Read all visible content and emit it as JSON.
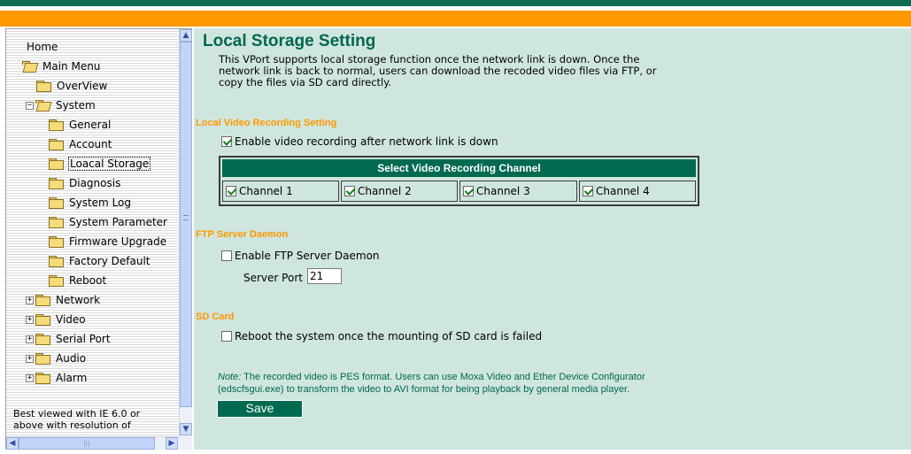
{
  "colors": {
    "header_green": "#0f6b50",
    "header_orange": "#ff9900",
    "content_background": "#cfe6de",
    "title_green": "#006650",
    "section_orange": "#ff9900",
    "button_green": "#006a50"
  },
  "sidebar": {
    "home": "Home",
    "main_menu": "Main Menu",
    "items": [
      {
        "label": "OverView",
        "icon": "folder-icon"
      },
      {
        "label": "System",
        "icon": "folder-open-icon",
        "expanded": true
      },
      {
        "label": "General",
        "icon": "folder-icon"
      },
      {
        "label": "Account",
        "icon": "folder-icon"
      },
      {
        "label": "Loacal Storage",
        "icon": "folder-icon",
        "selected": true
      },
      {
        "label": "Diagnosis",
        "icon": "folder-icon"
      },
      {
        "label": "System Log",
        "icon": "folder-icon"
      },
      {
        "label": "System Parameter",
        "icon": "folder-icon"
      },
      {
        "label": "Firmware Upgrade",
        "icon": "folder-icon"
      },
      {
        "label": "Factory Default",
        "icon": "folder-icon"
      },
      {
        "label": "Reboot",
        "icon": "folder-icon"
      },
      {
        "label": "Network",
        "icon": "folder-icon",
        "expanded": false
      },
      {
        "label": "Video",
        "icon": "folder-icon",
        "expanded": false
      },
      {
        "label": "Serial Port",
        "icon": "folder-icon",
        "expanded": false
      },
      {
        "label": "Audio",
        "icon": "folder-icon",
        "expanded": false
      },
      {
        "label": "Alarm",
        "icon": "folder-icon",
        "expanded": false
      }
    ],
    "footer_line1": "Best viewed with IE 6.0 or",
    "footer_line2": "above with resolution of"
  },
  "main": {
    "title": "Local Storage Setting",
    "intro_line1": "This VPort supports local storage function once the network link is down. Once the",
    "intro_line2": "network link is back to normal, users can download the recoded video files via FTP, or",
    "intro_line3": "copy the files via SD card directly.",
    "recording_section": {
      "title": "Local Video Recording Setting",
      "enable_label": "Enable video recording after network link is down",
      "enable_checked": true,
      "table_header": "Select Video Recording Channel",
      "channels": [
        {
          "label": "Channel 1",
          "checked": true
        },
        {
          "label": "Channel 2",
          "checked": true
        },
        {
          "label": "Channel 3",
          "checked": true
        },
        {
          "label": "Channel 4",
          "checked": true
        }
      ]
    },
    "ftp_section": {
      "title": "FTP Server Daemon",
      "enable_label": "Enable FTP Server Daemon",
      "enable_checked": false,
      "port_label": "Server Port",
      "port_value": "21"
    },
    "sd_section": {
      "title": "SD Card",
      "reboot_label": "Reboot the system once the mounting of SD card is failed",
      "reboot_checked": false
    },
    "note_prefix": "Note:",
    "note_text1": " The recorded video is PES format. Users can use Moxa Video and Ether Device Configurator",
    "note_text2": "(edscfsgui.exe) to transform the video to AVI format for being playback by general media player.",
    "save_label": "Save"
  }
}
